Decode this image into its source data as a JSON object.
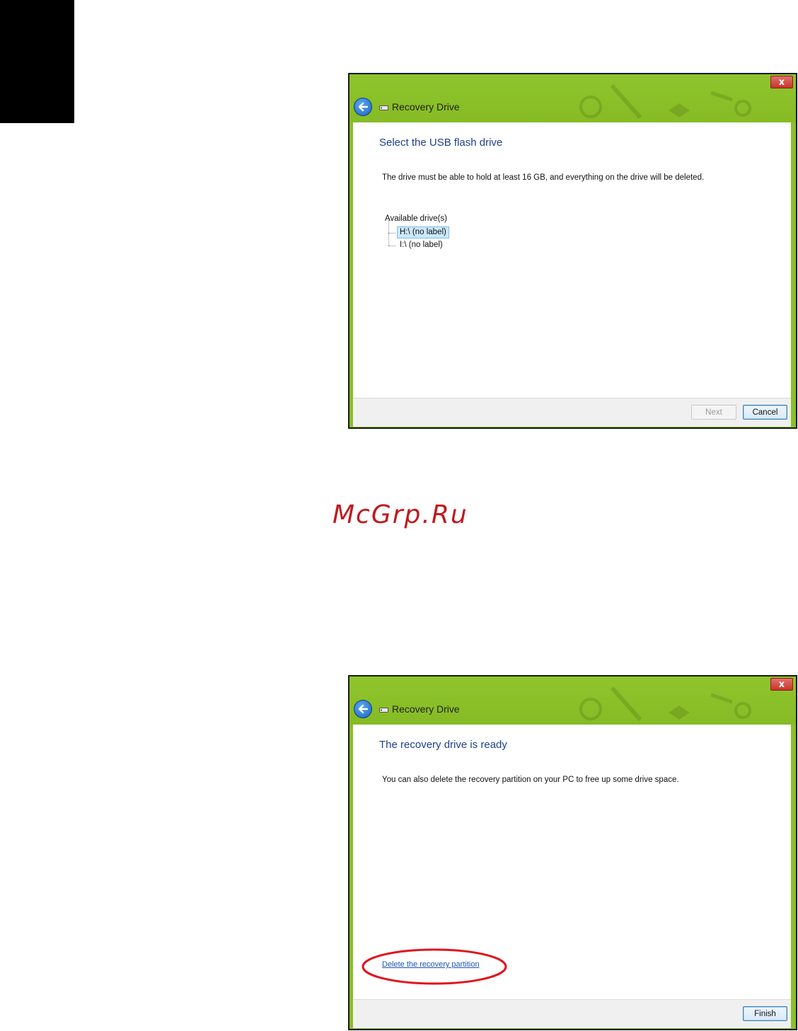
{
  "watermark": "McGrp.Ru",
  "window1": {
    "title": "Recovery Drive",
    "close_glyph": "x",
    "heading": "Select the USB flash drive",
    "description": "The drive must be able to hold at least 16 GB, and everything on the drive will be deleted.",
    "tree_root": "Available drive(s)",
    "drives": [
      {
        "label": "H:\\ (no label)",
        "selected": true
      },
      {
        "label": "I:\\ (no label)",
        "selected": false
      }
    ],
    "next_label": "Next",
    "cancel_label": "Cancel"
  },
  "window2": {
    "title": "Recovery Drive",
    "close_glyph": "x",
    "heading": "The recovery drive is ready",
    "description": "You can also delete the recovery partition on your PC to free up some drive space.",
    "link_label": "Delete the recovery partition",
    "finish_label": "Finish"
  },
  "colors": {
    "titlebar_green": "#8bbf2a",
    "heading_blue": "#1e3f8e",
    "annotation_red": "#e0141e",
    "watermark_red": "#c0191f"
  },
  "icons": [
    "back-arrow-icon",
    "usb-drive-icon",
    "close-icon"
  ]
}
